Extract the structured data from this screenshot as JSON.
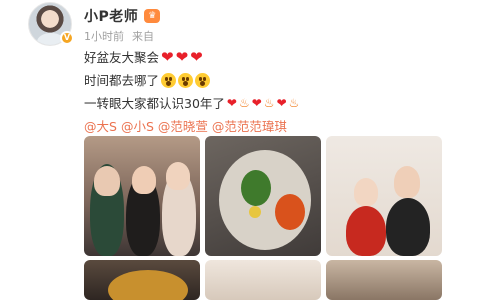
{
  "author": {
    "name": "小P老师",
    "level_badge_icon": "crown-icon",
    "verified_icon": "verified-badge-icon"
  },
  "meta": {
    "time": "1小时前",
    "source_prefix": "来自"
  },
  "post": {
    "lines": [
      "好盆友大聚会",
      "时间都去哪了",
      "一转眼大家都认识30年了"
    ],
    "mentions": [
      "@大S",
      "@小S",
      "@范晓萱",
      "@范范范瑋琪"
    ]
  },
  "photos": [
    {
      "name": "group-selfie-photo"
    },
    {
      "name": "food-plate-photo"
    },
    {
      "name": "couple-photo"
    },
    {
      "name": "photo-4"
    },
    {
      "name": "photo-5"
    },
    {
      "name": "photo-6"
    }
  ],
  "colors": {
    "mention": "#eb7350",
    "heart": "#e8202a",
    "fire": "#f07a1a",
    "meta": "#a0a0a0"
  }
}
